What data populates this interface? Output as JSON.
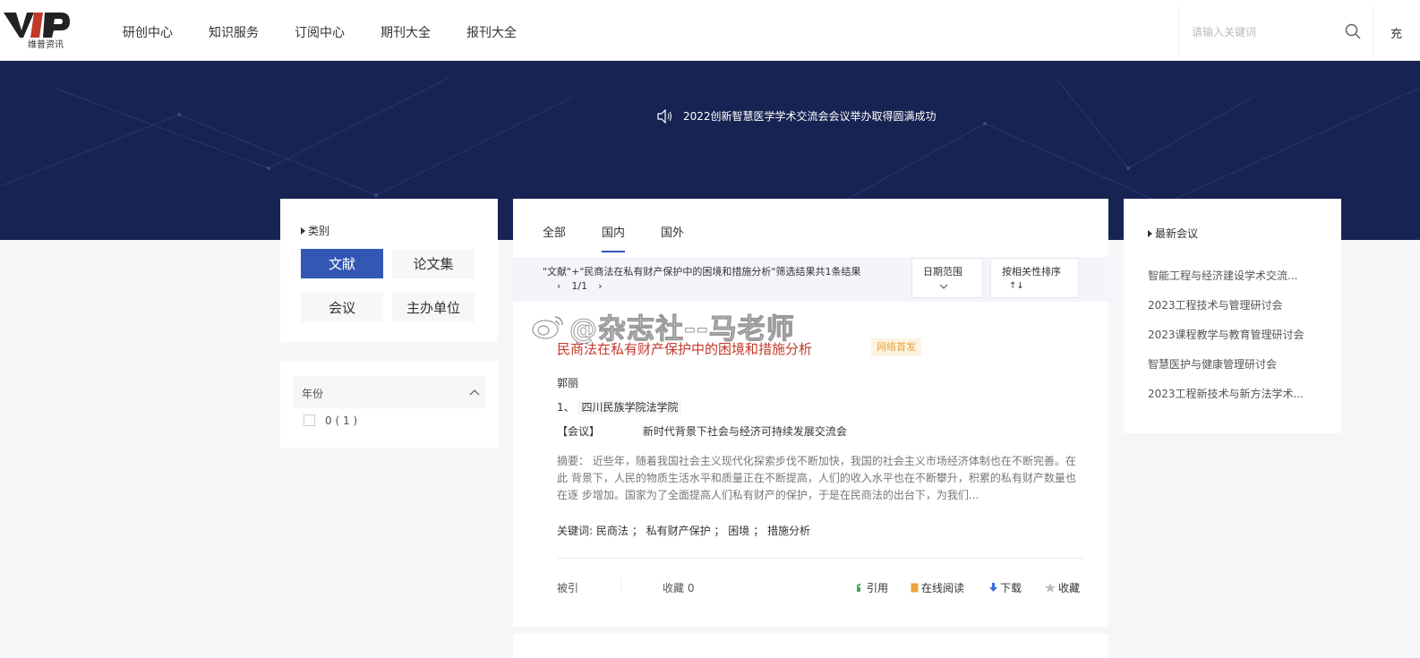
{
  "header": {
    "logo_sub": "维普资讯",
    "nav": [
      "研创中心",
      "知识服务",
      "订阅中心",
      "期刊大全",
      "报刊大全"
    ],
    "search_placeholder": "请输入关键词",
    "cut_text": "充"
  },
  "banner": {
    "notice": "2022创新智慧医学学术交流会会议举办取得圆满成功"
  },
  "category": {
    "title": "类别",
    "buttons": [
      "文献",
      "论文集",
      "会议",
      "主办单位"
    ],
    "active": "文献"
  },
  "year_filter": {
    "title": "年份",
    "item": "0 ( 1 )"
  },
  "main": {
    "tabs": [
      "全部",
      "国内",
      "国外"
    ],
    "active_tab": "国内",
    "filter_text": "\"文献\"+\"民商法在私有财产保护中的困境和措施分析\"筛选结果共1条结果",
    "pager": {
      "prev": "‹",
      "page": "1/1",
      "next": "›"
    },
    "date_range": "日期范围",
    "sort": "按相关性排序",
    "sort_icon": "↑↓"
  },
  "result": {
    "title": "民商法在私有财产保护中的困境和措施分析",
    "badge": "网络首发",
    "author": "郭丽",
    "org_prefix": "1、",
    "org": "四川民族学院法学院",
    "conf_tag": "【会议】",
    "conf_name": "新时代背景下社会与经济可持续发展交流会",
    "abstract": "摘要： 近些年，随着我国社会主义现代化探索步伐不断加快，我国的社会主义市场经济体制也在不断完善。在此 背景下，人民的物质生活水平和质量正在不断提高，人们的收入水平也在不断攀升，积累的私有财产数量也在逐 步增加。国家为了全面提高人们私有财产的保护，于是在民商法的出台下，为我们...",
    "keywords_label": "关键词:",
    "keywords": [
      "民商法",
      "私有财产保护",
      "困境",
      "措施分析"
    ],
    "cited_label": "被引",
    "fav_count_label": "收藏 0",
    "actions": {
      "cite": "引用",
      "read": "在线阅读",
      "download": "下载",
      "favorite": "收藏"
    }
  },
  "latest": {
    "title": "最新会议",
    "items": [
      "智能工程与经济建设学术交流...",
      "2023工程技术与管理研讨会",
      "2023课程教学与教育管理研讨会",
      "智慧医护与健康管理研讨会",
      "2023工程新技术与新方法学术..."
    ]
  },
  "watermark": "@杂志社--马老师",
  "colors": {
    "brand": "#3258b3",
    "banner": "#172352",
    "title_red": "#c0392b",
    "badge": "#e6a23c"
  }
}
